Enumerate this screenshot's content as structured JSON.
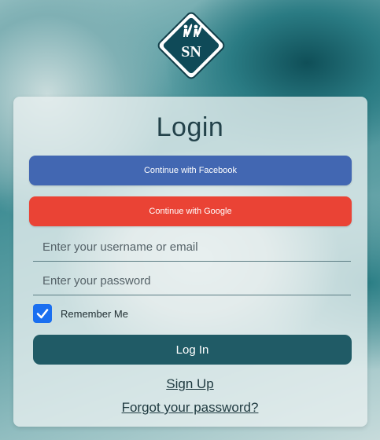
{
  "logo": {
    "text": "SN",
    "icon": "surfers-logo-icon"
  },
  "title": "Login",
  "social": {
    "facebook_label": "Continue with Facebook",
    "google_label": "Continue with Google",
    "facebook_color": "#4267b2",
    "google_color": "#ea4335"
  },
  "form": {
    "username_placeholder": "Enter your username or email",
    "username_value": "",
    "password_placeholder": "Enter your password",
    "password_value": "",
    "remember_label": "Remember Me",
    "remember_checked": true,
    "login_label": "Log In",
    "login_color": "#205b66"
  },
  "links": {
    "signup": "Sign Up",
    "forgot": "Forgot your password?"
  }
}
